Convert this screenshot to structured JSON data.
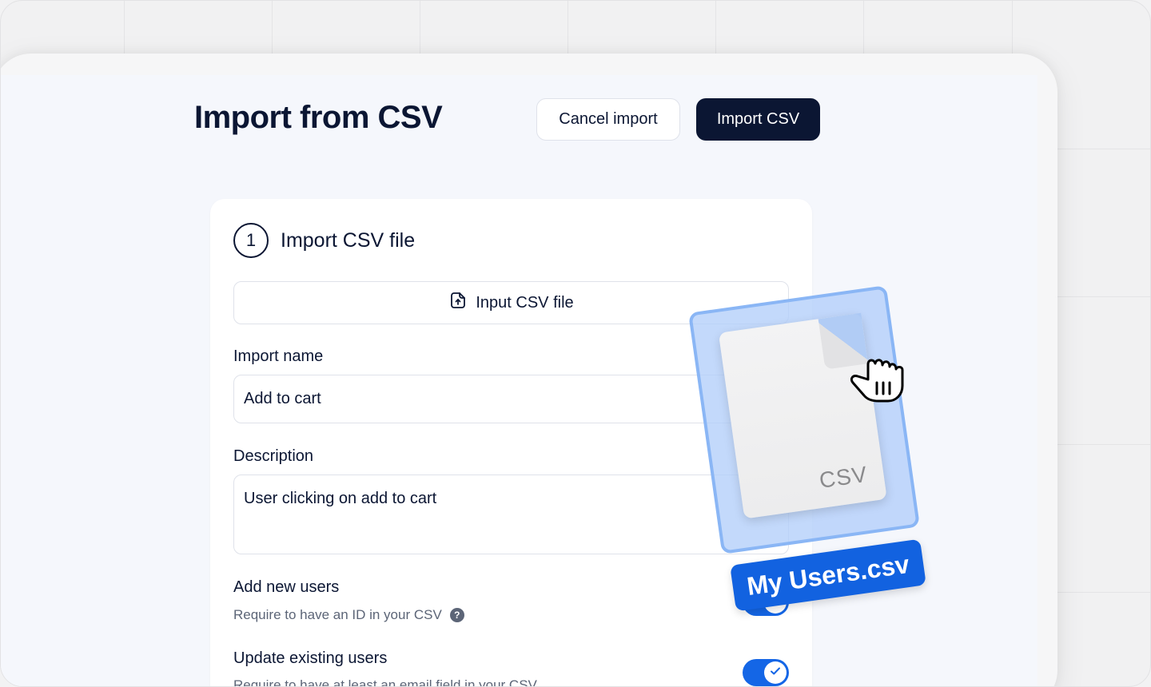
{
  "page": {
    "title": "Import from CSV",
    "cancel_label": "Cancel import",
    "import_label": "Import CSV"
  },
  "step": {
    "number": "1",
    "title": "Import CSV file",
    "file_button_label": "Input CSV file"
  },
  "form": {
    "import_name_label": "Import name",
    "import_name_value": "Add to cart",
    "description_label": "Description",
    "description_value": "User clicking on add to cart",
    "add_users_label": "Add new users",
    "add_users_hint": "Require to have an ID in your CSV",
    "update_users_label": "Update existing users",
    "update_users_hint": "Require to have at least an email field in your CSV",
    "add_users_enabled": true,
    "update_users_enabled": true
  },
  "drag": {
    "doc_type": "CSV",
    "filename": "My Users.csv"
  },
  "colors": {
    "primary": "#0b1633",
    "accent": "#1466e6",
    "drag_overlay": "#b2cefa"
  }
}
